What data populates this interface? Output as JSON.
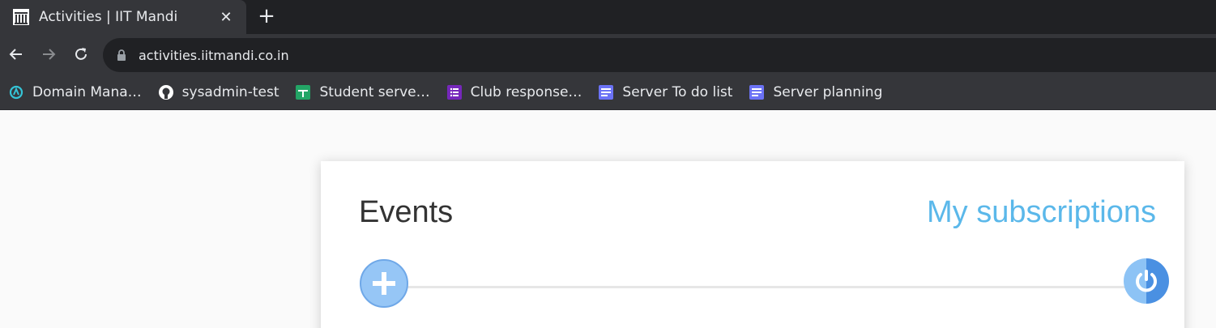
{
  "browser": {
    "tab": {
      "title": "Activities | IIT Mandi",
      "close_symbol": "✕"
    },
    "new_tab_symbol": "+",
    "address_bar": {
      "url": "activities.iitmandi.co.in"
    },
    "bookmarks": [
      {
        "label": "Domain Mana…",
        "icon": "domain-icon",
        "color": "#35c4d6"
      },
      {
        "label": "sysadmin-test",
        "icon": "github-icon",
        "color": "#ffffff"
      },
      {
        "label": "Student serve…",
        "icon": "sheets-icon",
        "color": "#23a566"
      },
      {
        "label": "Club response…",
        "icon": "forms-icon",
        "color": "#7627bb"
      },
      {
        "label": "Server To do list",
        "icon": "docs-icon",
        "color": "#6b72f5"
      },
      {
        "label": "Server planning",
        "icon": "docs-icon",
        "color": "#6b72f5"
      }
    ]
  },
  "card": {
    "title": "Events",
    "subscriptions_link": "My subscriptions",
    "add_icon": "plus-icon",
    "power_icon": "power-icon"
  },
  "colors": {
    "accent_link": "#5bb8ea",
    "add_button": "#96c6f6",
    "power_button": "#4a90e2"
  }
}
